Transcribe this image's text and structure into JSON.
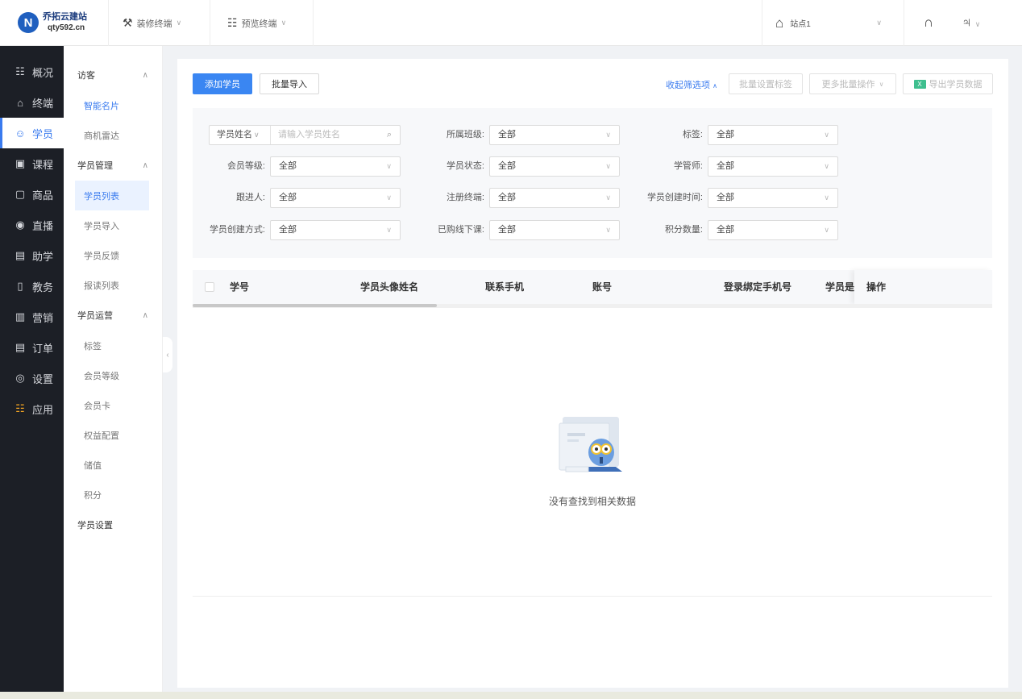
{
  "brand": {
    "mark": "N",
    "name": "乔拓云建站",
    "domain": "qty592.cn"
  },
  "top_menu": [
    {
      "label": "装修终端",
      "icon": "paint-roller-icon"
    },
    {
      "label": "预览终端",
      "icon": "qr-grid-icon"
    }
  ],
  "site": {
    "label": "站点1",
    "icon": "bank-icon"
  },
  "top_icons": [
    "headset-icon",
    "user-icon"
  ],
  "sidebar": [
    {
      "label": "概况",
      "icon": "grid-icon"
    },
    {
      "label": "终端",
      "icon": "store-icon"
    },
    {
      "label": "学员",
      "icon": "users-icon",
      "active": true
    },
    {
      "label": "课程",
      "icon": "course-icon"
    },
    {
      "label": "商品",
      "icon": "bag-icon"
    },
    {
      "label": "直播",
      "icon": "live-icon"
    },
    {
      "label": "助学",
      "icon": "assist-icon"
    },
    {
      "label": "教务",
      "icon": "book-icon"
    },
    {
      "label": "营销",
      "icon": "gift-icon"
    },
    {
      "label": "订单",
      "icon": "order-icon"
    },
    {
      "label": "设置",
      "icon": "settings-icon"
    },
    {
      "label": "应用",
      "icon": "apps-icon"
    }
  ],
  "submenu": {
    "group_visitors": "访客",
    "visitors": [
      "智能名片",
      "商机雷达"
    ],
    "group_manage": "学员管理",
    "manage": [
      "学员列表",
      "学员导入",
      "学员反馈",
      "报读列表"
    ],
    "group_ops": "学员运营",
    "ops": [
      "标签",
      "会员等级",
      "会员卡",
      "权益配置",
      "储值",
      "积分"
    ],
    "group_settings": "学员设置"
  },
  "toolbar": {
    "add": "添加学员",
    "import": "批量导入",
    "collapse": "收起筛选项",
    "set_tags": "批量设置标签",
    "more": "更多批量操作",
    "export": "导出学员数据"
  },
  "filters": {
    "name_type": "学员姓名",
    "name_placeholder": "请输入学员姓名",
    "rows": [
      [
        {
          "label": "所属班级:",
          "value": "全部"
        },
        {
          "label": "标签:",
          "value": "全部"
        }
      ],
      [
        {
          "label": "会员等级:",
          "value": "全部"
        },
        {
          "label": "学员状态:",
          "value": "全部"
        },
        {
          "label": "学管师:",
          "value": "全部"
        }
      ],
      [
        {
          "label": "跟进人:",
          "value": "全部"
        },
        {
          "label": "注册终端:",
          "value": "全部"
        },
        {
          "label": "学员创建时间:",
          "value": "全部"
        }
      ],
      [
        {
          "label": "学员创建方式:",
          "value": "全部"
        },
        {
          "label": "已购线下课:",
          "value": "全部"
        },
        {
          "label": "积分数量:",
          "value": "全部"
        }
      ]
    ]
  },
  "table": {
    "columns": [
      "学号",
      "学员头像姓名",
      "联系手机",
      "账号",
      "登录绑定手机号",
      "学员是否",
      "操作"
    ],
    "empty_text": "没有查找到相关数据"
  },
  "colors": {
    "primary": "#3a86f2",
    "sidebar_bg": "#1c1f26"
  }
}
